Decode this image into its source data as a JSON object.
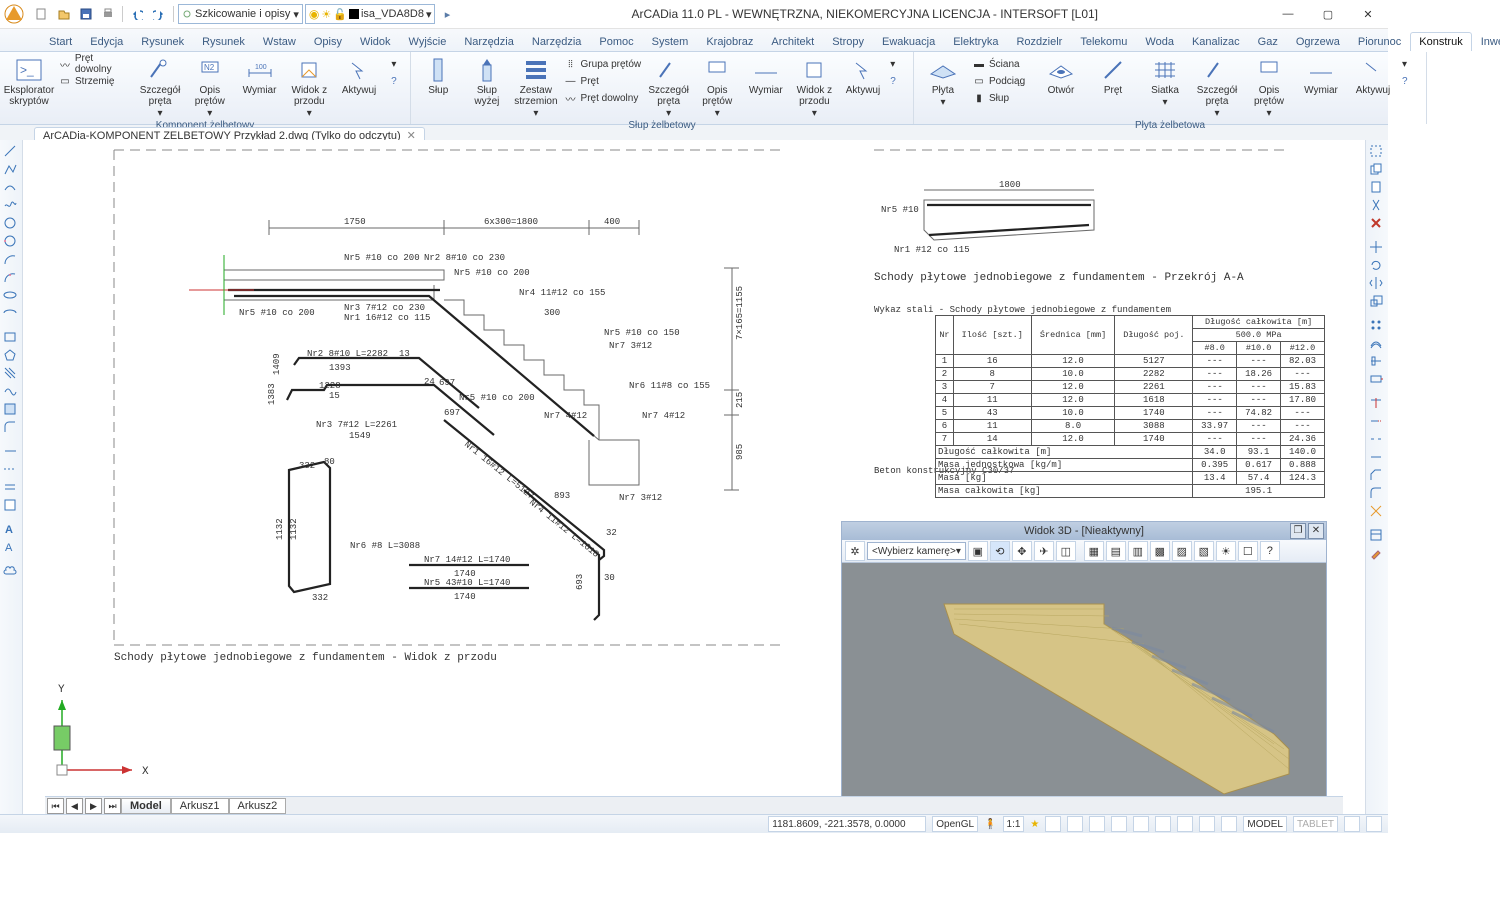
{
  "title": "ArCADia 11.0 PL - WEWNĘTRZNA, NIEKOMERCYJNA LICENCJA - INTERSOFT [L01]",
  "qat": {
    "sketching_combo": "Szkicowanie i opisy",
    "layer_combo": "isa_VDA8D8"
  },
  "tabs": [
    "Start",
    "Edycja",
    "Rysunek",
    "Rysunek",
    "Wstaw",
    "Opisy",
    "Widok",
    "Wyjście",
    "Narzędzia",
    "Narzędzia",
    "Pomoc",
    "System",
    "Krajobraz",
    "Architekt",
    "Stropy",
    "Ewakuacja",
    "Elektryka",
    "Rozdzielr",
    "Telekomu",
    "Woda",
    "Kanalizac",
    "Gaz",
    "Ogrzewa",
    "Piorunoc",
    "Konstruk",
    "Inwentar"
  ],
  "active_tab": "Konstruk",
  "ribbon": {
    "g1": {
      "title": "Komponent żelbetowy",
      "btns": {
        "eksplorator": "Eksplorator skryptów",
        "pret_dowolny": "Pręt dowolny",
        "strzemie": "Strzemię",
        "szczegol_preta": "Szczegół pręta",
        "opis_pretow": "Opis prętów",
        "wymiar": "Wymiar",
        "widok_z_przodu": "Widok z przodu",
        "aktywuj": "Aktywuj"
      }
    },
    "g2": {
      "title": "Słup żelbetowy",
      "btns": {
        "slup": "Słup",
        "slup_wyzej": "Słup wyżej",
        "zestaw": "Zestaw strzemion",
        "grupa_pretow": "Grupa prętów",
        "pret": "Pręt",
        "pret_dowolny": "Pręt dowolny",
        "szczegol_preta": "Szczegół pręta",
        "opis_pretow": "Opis prętów",
        "wymiar": "Wymiar",
        "widok_z_przodu": "Widok z przodu",
        "aktywuj": "Aktywuj"
      }
    },
    "g3": {
      "title": "Płyta żelbetowa",
      "btns": {
        "plyta": "Płyta",
        "sciana": "Ściana",
        "podciag": "Podciąg",
        "slup": "Słup",
        "otwor": "Otwór",
        "pret": "Pręt",
        "siatka": "Siatka",
        "szczegol_preta": "Szczegół pręta",
        "opis_pretow": "Opis prętów",
        "wymiar": "Wymiar",
        "aktywuj": "Aktywuj"
      }
    }
  },
  "doc_tab": "ArCADia-KOMPONENT ZELBETOWY Przykład 2.dwg (Tylko do odczytu)",
  "drawing": {
    "dims": {
      "d1750": "1750",
      "d6x300": "6x300=1800",
      "d400": "400",
      "d7x165": "7×165=1155",
      "d215": "215",
      "d985": "985",
      "d1800": "1800"
    },
    "bars": {
      "nr2_810": "Nr2 8#10 co 230",
      "nr5_10_200a": "Nr5 #10 co 200",
      "nr5_10_200b": "Nr5 #10 co 200",
      "nr4_1112": "Nr4 11#12 co 155",
      "nr3_712": "Nr3 7#12 co 230",
      "nr1_1612a": "Nr1 16#12 co 115",
      "nr5_10_150": "Nr5 #10 co 150",
      "nr7_312a": "Nr7 3#12",
      "nr6_1118": "Nr6 11#8 co 155",
      "nr5_10_200c": "Nr5 #10 co 200",
      "nr7_412a": "Nr7 4#12",
      "nr7_412b": "Nr7 4#12",
      "nr7_312b": "Nr7 3#12",
      "nr5_10": "Nr5 #10",
      "nr1_12_115": "Nr1 #12 co 115",
      "d300": "300"
    },
    "bar_schedules": {
      "nr2": {
        "label": "Nr2 8#10 L=2282",
        "d1": "1393",
        "d2": "697",
        "d3": "13",
        "d4": "1409"
      },
      "nr3": {
        "label": "Nr3 7#12 L=2261",
        "d1": "1549",
        "d2": "697",
        "d3": "24",
        "d4": "1383",
        "d5": "1228",
        "d6": "15"
      },
      "nr1": {
        "label": "Nr1 16#12 L=5127"
      },
      "nr4": {
        "label": "Nr4 11#12 L=1618",
        "d1": "893",
        "d2": "32",
        "d3": "693",
        "d4": "30"
      },
      "nr6": {
        "label": "Nr6 #8 L=3088",
        "d1": "332",
        "d2": "1132",
        "d3": "1132",
        "d4": "332",
        "d5": "80"
      },
      "nr7": {
        "label": "Nr7 14#12 L=1740",
        "d": "1740"
      },
      "nr5": {
        "label": "Nr5 43#10 L=1740",
        "d": "1740"
      }
    },
    "caption_left": "Schody płytowe jednobiegowe z fundamentem - Widok z przodu",
    "caption_right": "Schody płytowe jednobiegowe z fundamentem - Przekrój A-A",
    "table_title": "Wykaz stali - Schody płytowe jednobiegowe z fundamentem",
    "concrete_line": "Beton konstrukcyjny C30/37"
  },
  "steel_table": {
    "head": {
      "nr": "Nr",
      "ilosc": "Ilość [szt.]",
      "srednica": "Średnica [mm]",
      "dl_poj": "Długość poj.",
      "dl_calk": "Długość całkowita [m]",
      "grade": "500.0 MPa",
      "d8": "#8.0",
      "d10": "#10.0",
      "d12": "#12.0"
    },
    "rows": [
      {
        "nr": "1",
        "il": "16",
        "sr": "12.0",
        "dp": "5127",
        "d8": "---",
        "d10": "---",
        "d12": "82.03"
      },
      {
        "nr": "2",
        "il": "8",
        "sr": "10.0",
        "dp": "2282",
        "d8": "---",
        "d10": "18.26",
        "d12": "---"
      },
      {
        "nr": "3",
        "il": "7",
        "sr": "12.0",
        "dp": "2261",
        "d8": "---",
        "d10": "---",
        "d12": "15.83"
      },
      {
        "nr": "4",
        "il": "11",
        "sr": "12.0",
        "dp": "1618",
        "d8": "---",
        "d10": "---",
        "d12": "17.80"
      },
      {
        "nr": "5",
        "il": "43",
        "sr": "10.0",
        "dp": "1740",
        "d8": "---",
        "d10": "74.82",
        "d12": "---"
      },
      {
        "nr": "6",
        "il": "11",
        "sr": "8.0",
        "dp": "3088",
        "d8": "33.97",
        "d10": "---",
        "d12": "---"
      },
      {
        "nr": "7",
        "il": "14",
        "sr": "12.0",
        "dp": "1740",
        "d8": "---",
        "d10": "---",
        "d12": "24.36"
      }
    ],
    "summary": {
      "dl_calk_lbl": "Długość całkowita [m]",
      "dl_calk": [
        "34.0",
        "93.1",
        "140.0"
      ],
      "masa_jedn_lbl": "Masa jednostkowa [kg/m]",
      "masa_jedn": [
        "0.395",
        "0.617",
        "0.888"
      ],
      "masa_lbl": "Masa [kg]",
      "masa": [
        "13.4",
        "57.4",
        "124.3"
      ],
      "masa_calk_lbl": "Masa całkowita [kg]",
      "masa_calk": "195.1"
    }
  },
  "view3d": {
    "title": "Widok 3D - [Nieaktywny]",
    "camera": "<Wybierz kamerę>"
  },
  "model_tabs": [
    "Model",
    "Arkusz1",
    "Arkusz2"
  ],
  "status": {
    "coords": "1181.8609, -221.3578, 0.0000",
    "opengl": "OpenGL",
    "scale": "1:1",
    "model": "MODEL",
    "tablet": "TABLET"
  },
  "axis": {
    "x": "X",
    "y": "Y"
  }
}
